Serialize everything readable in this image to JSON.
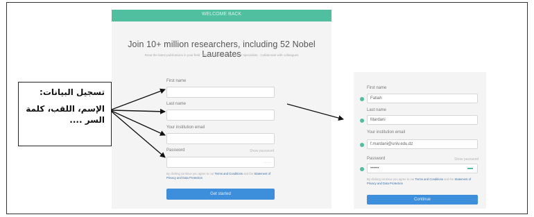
{
  "signup": {
    "header_text": "WELCOME BACK",
    "heading": "Join 10+ million researchers, including 52 Nobel Laureates",
    "subline": "Read the latest publications in your field · Discuss your work with other specialists · Collaborate with colleagues",
    "first_name_label": "First name",
    "last_name_label": "Last name",
    "email_label": "Your institution email",
    "password_label": "Password",
    "password_hint": "Show password",
    "password_strength": "······",
    "terms_text": "By clicking continue you agree to our",
    "terms_link": "Terms and Conditions",
    "terms_and": "and the",
    "privacy_link": "Statement of Privacy and Data Protection",
    "submit_label": "Get started"
  },
  "callout": {
    "title": "تسجيل البيانات:",
    "body": "الإسم، اللقب، كلمة السر ...."
  },
  "login": {
    "first_name_label": "First name",
    "first_name_value": "Fatiah",
    "last_name_label": "Last name",
    "last_name_value": "Mardani",
    "email_label": "Your institution email",
    "email_value": "f.mardani@univ.edu.dz",
    "password_label": "Password",
    "password_hint": "Show password",
    "password_value": "••••••",
    "terms_text": "By clicking continue you agree to our",
    "terms_link": "Terms and Conditions",
    "terms_and": "and the",
    "privacy_link": "Statement of Privacy and Data Protection",
    "submit_label": "Continue"
  },
  "colors": {
    "accent": "#4fbf9f",
    "button": "#3d8fdb"
  }
}
